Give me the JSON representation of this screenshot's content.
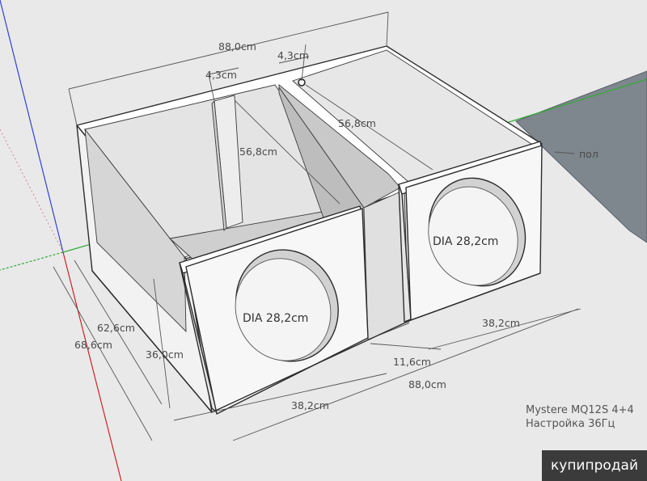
{
  "dimensions": {
    "overall_width_top": "88,0cm",
    "overall_width_bottom": "88,0cm",
    "partition_thickness_left": "4,3cm",
    "partition_thickness_right": "4,3cm",
    "inner_depth_left": "56,8cm",
    "inner_depth_right": "56,8cm",
    "depth_inner": "62,6cm",
    "depth_outer": "68,6cm",
    "height": "36,0cm",
    "chamber_width_left": "38,2cm",
    "chamber_width_right": "38,2cm",
    "port_width": "11,6cm"
  },
  "holes": {
    "left_diameter": "DIA 28,2cm",
    "right_diameter": "DIA 28,2cm"
  },
  "floor_label": "пол",
  "notes": {
    "line1": "Mystere MQ12S 4+4",
    "line2": "Настройка 36Гц"
  },
  "watermark": "купипродай"
}
